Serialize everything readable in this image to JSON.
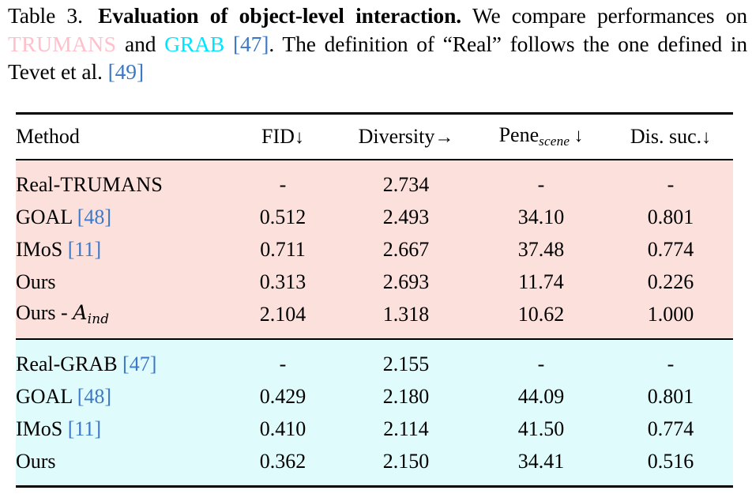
{
  "caption": {
    "label": "Table 3.",
    "bold_title": "Evaluation of object-level interaction.",
    "text_1": "We compare performances on",
    "dataset_1": "TRUMANS",
    "text_2": "and",
    "dataset_2": "GRAB",
    "cite_1": "[47]",
    "text_3": ". The definition of “Real” follows the one defined in Tevet et al.",
    "cite_2": "[49]"
  },
  "table": {
    "headers": {
      "method": "Method",
      "fid": "FID",
      "fid_arrow": "↓",
      "diversity": "Diversity",
      "diversity_arrow": "→",
      "pene": "Pene",
      "pene_sub": "scene",
      "pene_arrow": "↓",
      "dis": "Dis. suc.",
      "dis_arrow": "↓"
    },
    "sections": [
      {
        "name": "trumans-section",
        "bg_color": "#fbe0dc",
        "rows": [
          {
            "method_prefix": "Real-",
            "method_smallcaps": "TRUMANS",
            "method_cite": "",
            "fid": "-",
            "diversity": "2.734",
            "pene": "-",
            "dis": "-",
            "bold": {
              "fid": false,
              "diversity": false,
              "pene": false,
              "dis": false
            }
          },
          {
            "method_prefix": "GOAL ",
            "method_smallcaps": "",
            "method_cite": "[48]",
            "fid": "0.512",
            "diversity": "2.493",
            "pene": "34.10",
            "dis": "0.801",
            "bold": {
              "fid": false,
              "diversity": false,
              "pene": false,
              "dis": false
            }
          },
          {
            "method_prefix": "IMoS ",
            "method_smallcaps": "",
            "method_cite": "[11]",
            "fid": "0.711",
            "diversity": "2.667",
            "pene": "37.48",
            "dis": "0.774",
            "bold": {
              "fid": false,
              "diversity": false,
              "pene": false,
              "dis": false
            }
          },
          {
            "method_prefix": "Ours",
            "method_smallcaps": "",
            "method_cite": "",
            "fid": "0.313",
            "diversity": "2.693",
            "pene": "11.74",
            "dis": "0.226",
            "bold": {
              "fid": true,
              "diversity": true,
              "pene": false,
              "dis": true
            }
          },
          {
            "method_prefix": "Ours - ",
            "method_math": "A",
            "method_math_sub": "ind",
            "method_smallcaps": "",
            "method_cite": "",
            "fid": "2.104",
            "diversity": "1.318",
            "pene": "10.62",
            "dis": "1.000",
            "bold": {
              "fid": false,
              "diversity": false,
              "pene": true,
              "dis": false
            }
          }
        ]
      },
      {
        "name": "grab-section",
        "bg_color": "#e0fbfb",
        "rows": [
          {
            "method_prefix": "Real-GRAB ",
            "method_smallcaps": "",
            "method_cite": "[47]",
            "fid": "-",
            "diversity": "2.155",
            "pene": "-",
            "dis": "-",
            "bold": {
              "fid": false,
              "diversity": false,
              "pene": false,
              "dis": false
            }
          },
          {
            "method_prefix": "GOAL ",
            "method_smallcaps": "",
            "method_cite": "[48]",
            "fid": "0.429",
            "diversity": "2.180",
            "pene": "44.09",
            "dis": "0.801",
            "bold": {
              "fid": false,
              "diversity": false,
              "pene": false,
              "dis": false
            }
          },
          {
            "method_prefix": "IMoS ",
            "method_smallcaps": "",
            "method_cite": "[11]",
            "fid": "0.410",
            "diversity": "2.114",
            "pene": "41.50",
            "dis": "0.774",
            "bold": {
              "fid": false,
              "diversity": false,
              "pene": false,
              "dis": false
            }
          },
          {
            "method_prefix": "Ours",
            "method_smallcaps": "",
            "method_cite": "",
            "fid": "0.362",
            "diversity": "2.150",
            "pene": "34.41",
            "dis": "0.516",
            "bold": {
              "fid": false,
              "diversity": false,
              "pene": false,
              "dis": false
            }
          }
        ]
      }
    ]
  },
  "colors": {
    "citation_blue": "#3c78c8",
    "trumans_pink_text": "#ffc0cb",
    "grab_cyan_text": "#00e5ff",
    "section_pink_bg": "#fbe0dc",
    "section_cyan_bg": "#e0fbfb",
    "rule_black": "#000000"
  }
}
